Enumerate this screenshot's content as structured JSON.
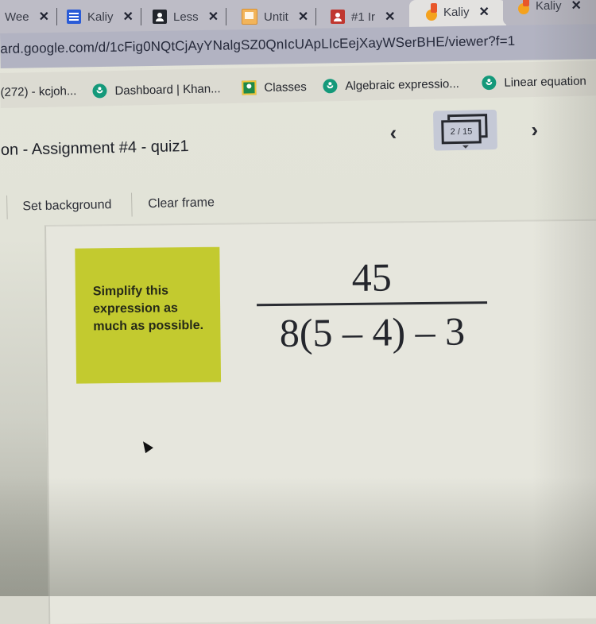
{
  "browser": {
    "tabs": [
      {
        "label": "Wee",
        "icon": "none",
        "close": "✕"
      },
      {
        "label": "Kaliy",
        "icon": "google-docs-icon",
        "close": "✕"
      },
      {
        "label": "Less",
        "icon": "google-classroom-icon",
        "close": "✕"
      },
      {
        "label": "Untit",
        "icon": "google-slides-icon",
        "close": "✕"
      },
      {
        "label": "#1 Ir",
        "icon": "google-classroom-assignment-icon",
        "close": "✕"
      },
      {
        "label": "Kaliy",
        "icon": "jamboard-icon",
        "close": "✕",
        "active": true
      },
      {
        "label": "Kaliy",
        "icon": "jamboard-icon",
        "close": "✕"
      }
    ],
    "url": "ard.google.com/d/1cFig0NQtCjAyYNalgSZ0QnIcUApLIcEejXayWSerBHE/viewer?f=1",
    "bookmarks": [
      {
        "label": "(272) - kcjoh...",
        "icon": "none"
      },
      {
        "label": "Dashboard | Khan...",
        "icon": "khan-academy-icon"
      },
      {
        "label": "Classes",
        "icon": "google-classroom-icon"
      },
      {
        "label": "Algebraic expressio...",
        "icon": "khan-academy-icon"
      },
      {
        "label": "Linear equation",
        "icon": "khan-academy-icon"
      }
    ]
  },
  "jamboard": {
    "title": "on - Assignment #4 - quiz1",
    "prev": "‹",
    "next": "›",
    "frame_indicator": "2 / 15",
    "toolbar": {
      "set_background": "Set background",
      "clear_frame": "Clear frame"
    },
    "sticky_note": {
      "text": "Simplify this expression as much as possible.",
      "color": "#c3ca2f"
    },
    "expression": {
      "numerator": "45",
      "denominator": "8(5 – 4) – 3"
    }
  }
}
